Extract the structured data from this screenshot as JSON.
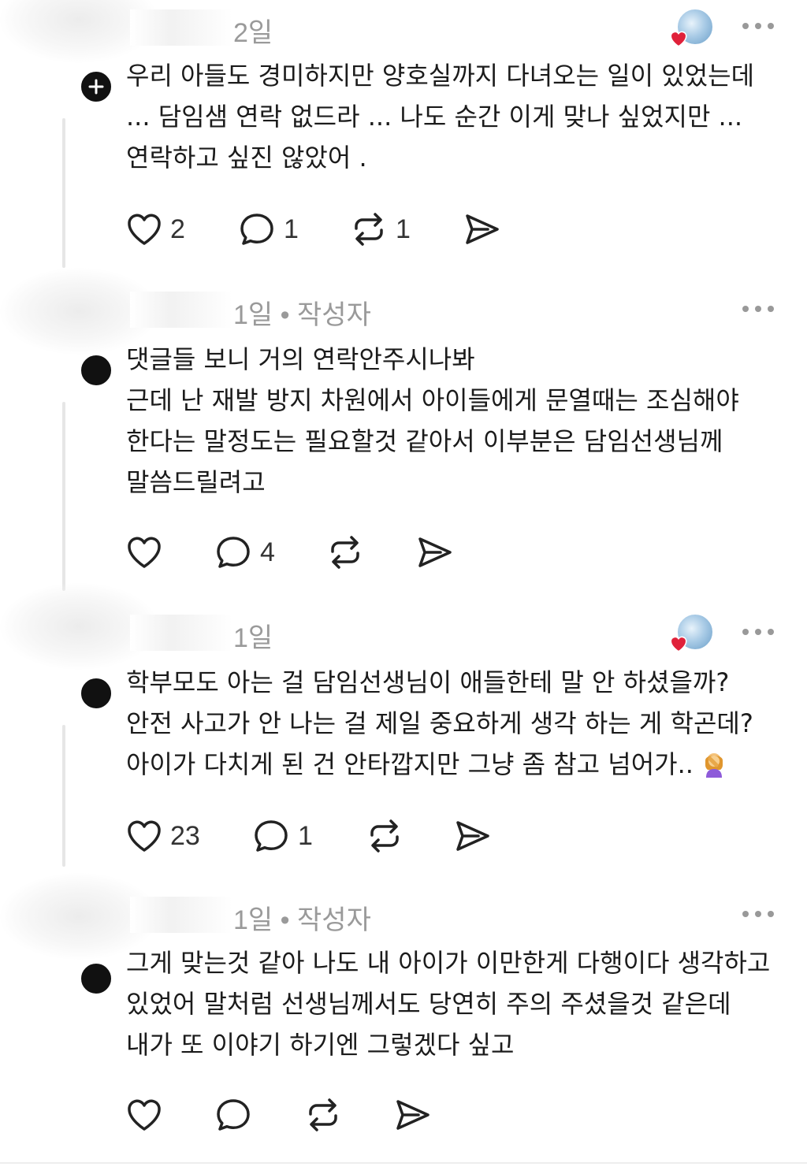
{
  "comments": [
    {
      "time": "2일",
      "author_tag": "",
      "liked_by_op": true,
      "lines": [
        "우리 아들도 경미하지만 양호실까지 다녀오는 일이 있었는데",
        "... 담임샘 연락 없드라 ... 나도 순간 이게 맞나 싶었지만 ...",
        "연락하고 싶진 않았어 ."
      ],
      "likes": "2",
      "replies": "1",
      "reposts": "1"
    },
    {
      "time": "1일",
      "author_tag": "• 작성자",
      "liked_by_op": false,
      "lines": [
        "댓글들 보니 거의 연락안주시나봐",
        "근데 난 재발 방지 차원에서 아이들에게 문열때는 조심해야",
        "한다는 말정도는 필요할것 같아서 이부분은 담임선생님께",
        "말씀드릴려고"
      ],
      "likes": "",
      "replies": "4",
      "reposts": ""
    },
    {
      "time": "1일",
      "author_tag": "",
      "liked_by_op": true,
      "lines": [
        "학부모도 아는 걸 담임선생님이 애들한테 말 안 하셨을까?",
        "안전 사고가 안 나는 걸 제일 중요하게 생각 하는 게 학곤데?",
        "아이가 다치게 된 건 안타깝지만 그냥 좀 참고 넘어가.."
      ],
      "emoji": "face-palm-emoji",
      "likes": "23",
      "replies": "1",
      "reposts": ""
    },
    {
      "time": "1일",
      "author_tag": "• 작성자",
      "liked_by_op": false,
      "lines": [
        "그게 맞는것 같아 나도 내 아이가 이만한게 다행이다 생각하고",
        "있었어 말처럼 선생님께서도 당연히 주의 주셨을것 같은데",
        "내가 또 이야기 하기엔 그렇겠다 싶고"
      ],
      "likes": "",
      "replies": "",
      "reposts": ""
    }
  ],
  "colors": {
    "text": "#1b1b1b",
    "meta": "#9a9a9a",
    "heart": "#e0213a",
    "icon": "#222222"
  },
  "icons": [
    "heart-icon",
    "comment-icon",
    "repost-icon",
    "share-icon",
    "more-icon",
    "plus-icon"
  ]
}
